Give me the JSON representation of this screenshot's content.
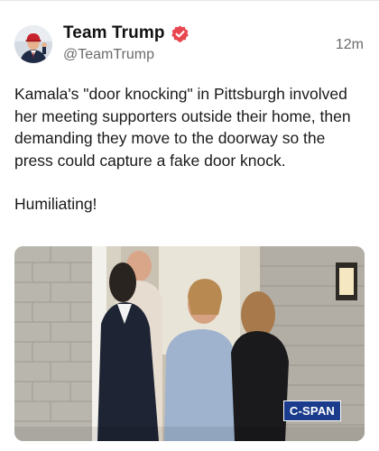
{
  "post": {
    "author": {
      "display_name": "Team Trump",
      "handle": "@TeamTrump",
      "verified": true,
      "avatar_icon": "profile-photo"
    },
    "timestamp": "12m",
    "body": {
      "paragraph_1": "Kamala's \"door knocking\" in Pittsburgh involved her meeting supporters outside their home, then demanding they move to the doorway so the press could capture a fake door knock.",
      "paragraph_2": "Humiliating!"
    },
    "media": {
      "type": "video-still",
      "watermark": "C-SPAN"
    }
  },
  "colors": {
    "verified_badge": "#e8464f",
    "cspan_blue": "#1b3c8c",
    "text_primary": "#1a1a1a",
    "text_secondary": "#6b6b6b"
  }
}
